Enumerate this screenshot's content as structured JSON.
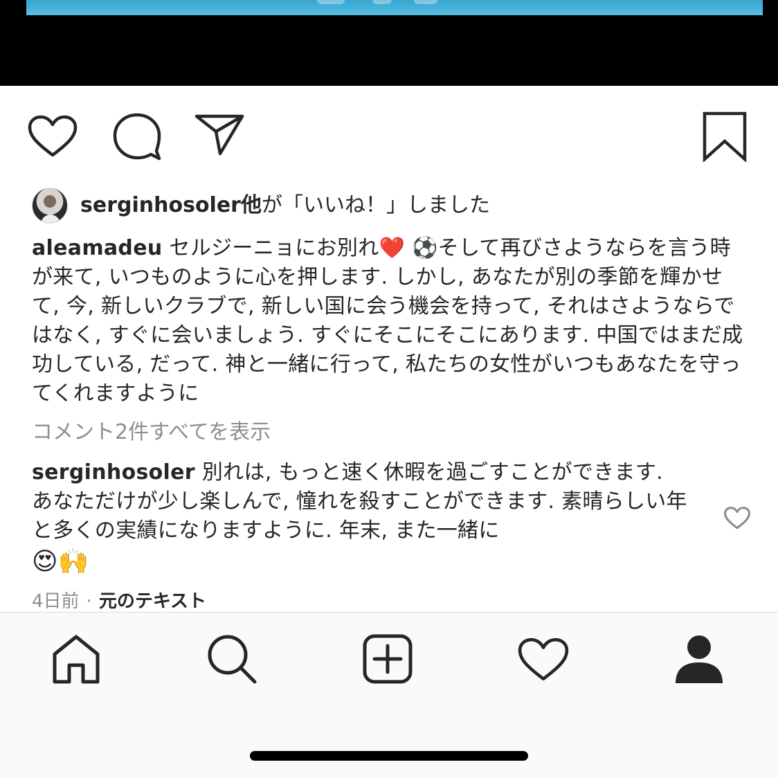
{
  "post": {
    "likes": {
      "user": "serginhosoler他",
      "suffix": "が「いいね！」しました"
    },
    "caption": {
      "username": "aleamadeu",
      "text": "セルジーニョにお別れ❤️ ⚽️そして再びさようならを言う時が来て, いつものように心を押します. しかし, あなたが別の季節を輝かせて, 今, 新しいクラブで, 新しい国に会う機会を持って, それはさようならではなく, すぐに会いましょう. すぐにそこにそこにあります. 中国ではまだ成功している, だって. 神と一緒に行って, 私たちの女性がいつもあなたを守ってくれますように"
    },
    "view_all_comments": "コメント2件すべてを表示",
    "comment": {
      "username": "serginhosoler",
      "text": "別れは, もっと速く休暇を過ごすことができます. あなただけが少し楽しんで, 憧れを殺すことができます. 素晴らしい年と多くの実績になりますように. 年末, また一緒に",
      "emoji": "😍🙌",
      "time": "4日前",
      "separator": "·",
      "translate_label": "元のテキスト"
    }
  },
  "icons": {
    "actions": [
      "heart-icon",
      "comment-icon",
      "share-icon",
      "bookmark-icon"
    ],
    "tabs": [
      "home-icon",
      "search-icon",
      "add-post-icon",
      "activity-heart-icon",
      "profile-icon"
    ]
  },
  "colors": {
    "text": "#262626",
    "muted": "#8e8e8e",
    "tabbar_bg": "#fafafa",
    "media_bg": "#000000"
  }
}
